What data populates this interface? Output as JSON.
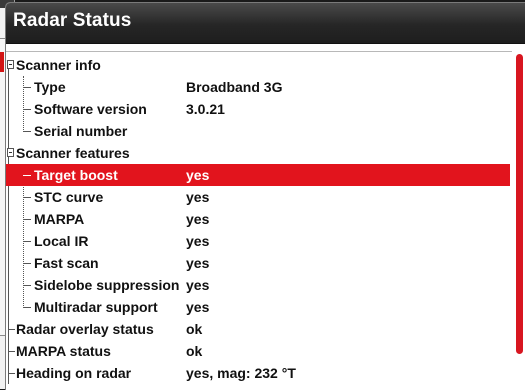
{
  "dialog": {
    "title": "Radar Status"
  },
  "rows": [
    {
      "label": "Scanner info",
      "value": ""
    },
    {
      "label": "Type",
      "value": "Broadband 3G"
    },
    {
      "label": "Software version",
      "value": "3.0.21"
    },
    {
      "label": "Serial number",
      "value": ""
    },
    {
      "label": "Scanner features",
      "value": ""
    },
    {
      "label": "Target boost",
      "value": "yes"
    },
    {
      "label": "STC curve",
      "value": "yes"
    },
    {
      "label": "MARPA",
      "value": "yes"
    },
    {
      "label": "Local IR",
      "value": "yes"
    },
    {
      "label": "Fast scan",
      "value": "yes"
    },
    {
      "label": "Sidelobe suppression",
      "value": "yes"
    },
    {
      "label": "Multiradar support",
      "value": "yes"
    },
    {
      "label": "Radar overlay status",
      "value": "ok"
    },
    {
      "label": "MARPA status",
      "value": "ok"
    },
    {
      "label": "Heading on radar",
      "value": "yes, mag: 232 °T"
    }
  ],
  "colors": {
    "selection": "#e2141d",
    "scrollbar": "#d81620",
    "titlebar": "#262626"
  }
}
